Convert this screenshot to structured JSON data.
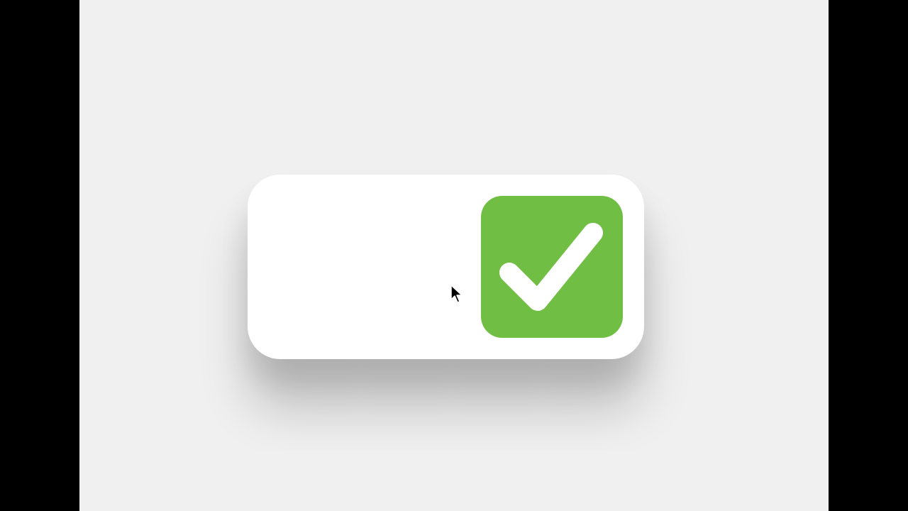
{
  "colors": {
    "background": "#f0f0f0",
    "letterbox": "#000000",
    "card": "#ffffff",
    "accent_green": "#70bf44",
    "check_mark": "#ffffff"
  },
  "icons": {
    "check": "check-icon",
    "cursor": "mouse-pointer-icon"
  },
  "checkbox": {
    "checked": true
  }
}
